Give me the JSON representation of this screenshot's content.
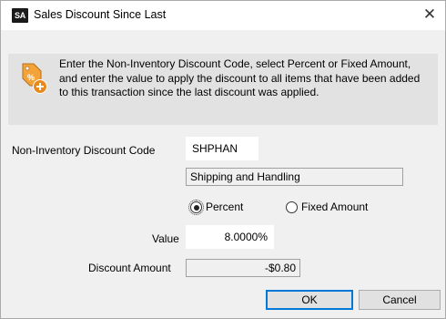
{
  "window": {
    "title": "Sales Discount Since Last",
    "app_icon_text": "SA",
    "close_glyph": "✕"
  },
  "info": {
    "icon": "discount-tag-add-icon",
    "text": "Enter the Non-Inventory Discount Code, select Percent or Fixed Amount, and enter the value to apply the discount to all items that have been added to this transaction since the last discount was applied."
  },
  "form": {
    "discount_code_label": "Non-Inventory Discount Code",
    "discount_code_value": "SHPHAN",
    "discount_description": "Shipping and Handling",
    "percent_label": "Percent",
    "fixed_amount_label": "Fixed Amount",
    "selected_mode": "Percent",
    "value_label": "Value",
    "value_value": "8.0000%",
    "discount_amount_label": "Discount Amount",
    "discount_amount_value": "-$0.80"
  },
  "buttons": {
    "ok_label": "OK",
    "cancel_label": "Cancel"
  },
  "colors": {
    "accent": "#0078d7",
    "dialog_bg": "#f0f0f0",
    "icon_orange": "#f3a33a"
  }
}
